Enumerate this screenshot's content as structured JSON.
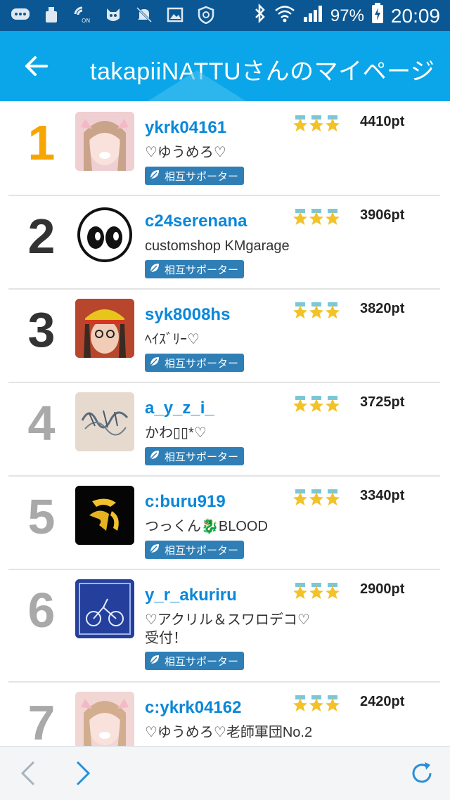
{
  "status": {
    "battery_pct": "97%",
    "time": "20:09"
  },
  "header": {
    "title": "takapiiNATTUさんのマイページ"
  },
  "list": [
    {
      "rank": "1",
      "rank_color": "#f7a600",
      "username": "ykrk04161",
      "points": "4410pt",
      "desc": "♡ゆうめろ♡",
      "badge": "相互サポーター"
    },
    {
      "rank": "2",
      "rank_color": "#333333",
      "username": "c24serenana",
      "points": "3906pt",
      "desc": "customshop KMgarage",
      "badge": "相互サポーター"
    },
    {
      "rank": "3",
      "rank_color": "#333333",
      "username": "syk8008hs",
      "points": "3820pt",
      "desc": "ﾍｲｽﾞﾘｰ♡",
      "badge": "相互サポーター"
    },
    {
      "rank": "4",
      "rank_color": "#a9a9a9",
      "username": "a_y_z_i_",
      "points": "3725pt",
      "desc": "かわ▯▯*♡",
      "badge": "相互サポーター"
    },
    {
      "rank": "5",
      "rank_color": "#a9a9a9",
      "username": "c:buru919",
      "points": "3340pt",
      "desc": "つっくん🐉BLOOD",
      "badge": "相互サポーター"
    },
    {
      "rank": "6",
      "rank_color": "#a9a9a9",
      "username": "y_r_akuriru",
      "points": "2900pt",
      "desc": "♡アクリル＆スワロデコ♡\n受付！",
      "badge": "相互サポーター"
    },
    {
      "rank": "7",
      "rank_color": "#a9a9a9",
      "username": "c:ykrk04162",
      "points": "2420pt",
      "desc": "♡ゆうめろ♡老師軍団No.2",
      "badge": ""
    }
  ]
}
